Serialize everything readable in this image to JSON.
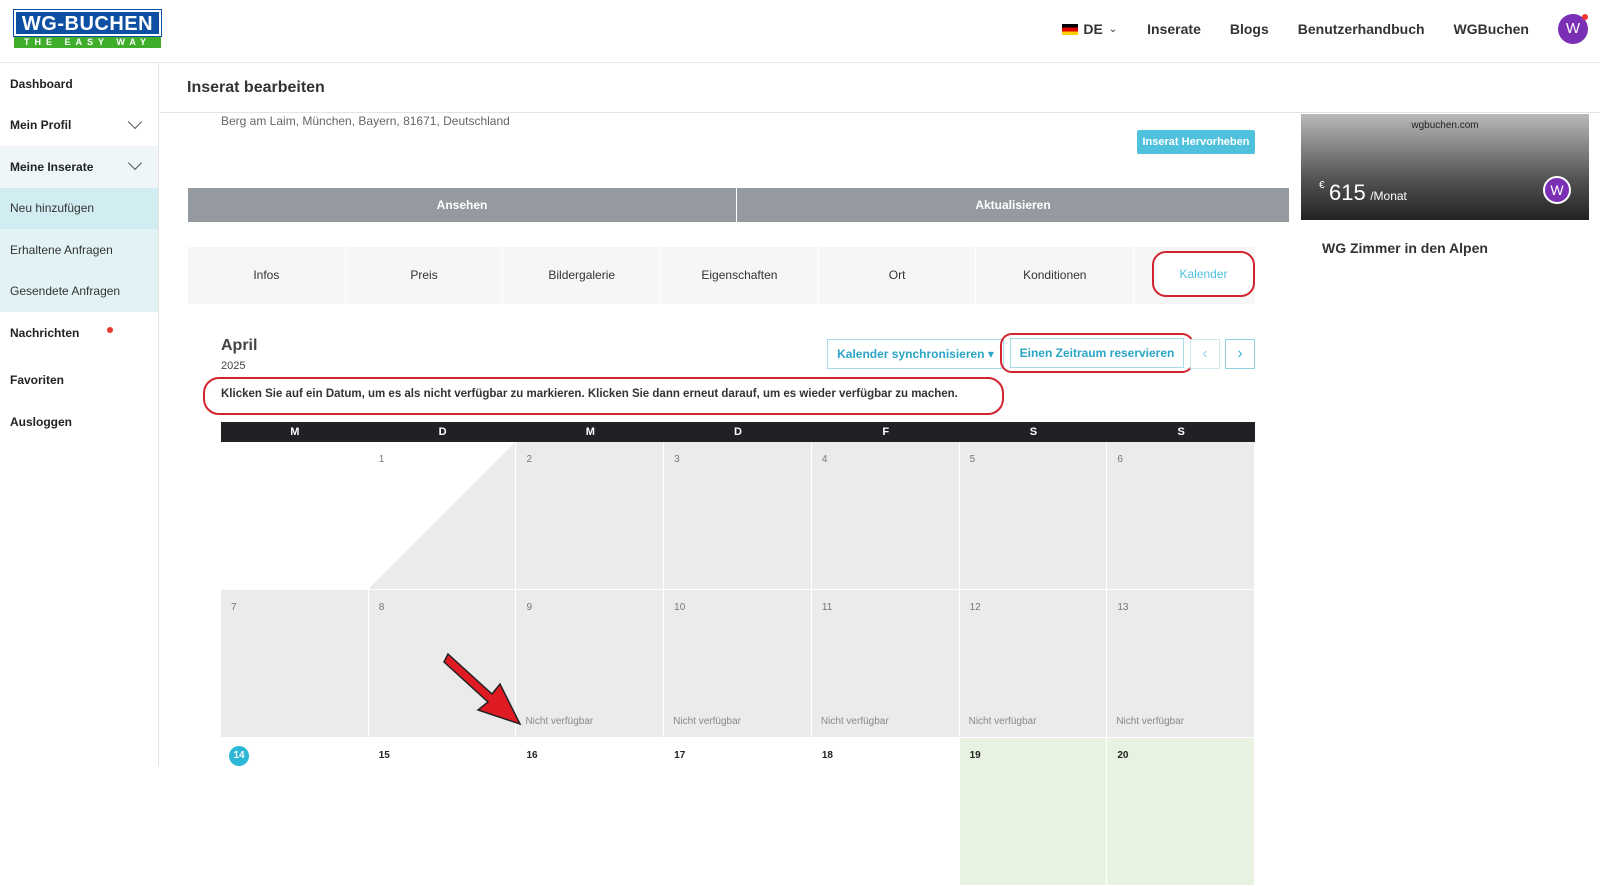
{
  "header": {
    "logo_main": "WG-BUCHEN",
    "logo_tagline": "THE EASY WAY",
    "language": "DE",
    "nav": [
      "Inserate",
      "Blogs",
      "Benutzerhandbuch",
      "WGBuchen"
    ],
    "avatar_letter": "W"
  },
  "sidebar": {
    "items": [
      {
        "label": "Dashboard"
      },
      {
        "label": "Mein Profil"
      },
      {
        "label": "Meine Inserate"
      },
      {
        "label": "Neu hinzufügen"
      },
      {
        "label": "Erhaltene Anfragen"
      },
      {
        "label": "Gesendete Anfragen"
      },
      {
        "label": "Nachrichten"
      },
      {
        "label": "Favoriten"
      },
      {
        "label": "Ausloggen"
      }
    ]
  },
  "page": {
    "title": "Inserat bearbeiten",
    "address": "Berg am Laim, München, Bayern, 81671, Deutschland",
    "highlight_button": "Inserat Hervorheben",
    "view_button": "Ansehen",
    "update_button": "Aktualisieren"
  },
  "tabs": [
    "Infos",
    "Preis",
    "Bildergalerie",
    "Eigenschaften",
    "Ort",
    "Konditionen",
    "Kalender"
  ],
  "calendar": {
    "month": "April",
    "year": "2025",
    "sync_button": "Kalender synchronisieren ▾",
    "reserve_button": "Einen Zeitraum reservieren",
    "prev": "‹",
    "next": "›",
    "hint": "Klicken Sie auf ein Datum, um es als nicht verfügbar zu markieren. Klicken Sie dann erneut darauf, um es wieder verfügbar zu machen.",
    "weekdays": [
      "M",
      "D",
      "M",
      "D",
      "F",
      "S",
      "S"
    ],
    "unavailable_label": "Nicht verfügbar",
    "week1": [
      "1",
      "2",
      "3",
      "4",
      "5",
      "6"
    ],
    "week2": [
      "7",
      "8",
      "9",
      "10",
      "11",
      "12",
      "13"
    ],
    "week3": [
      "14",
      "15",
      "16",
      "17",
      "18",
      "19",
      "20"
    ]
  },
  "preview": {
    "site": "wgbuchen.com",
    "currency": "€",
    "price": "615",
    "per": "/Monat",
    "avatar_letter": "W",
    "listing_title": "WG Zimmer in den Alpen"
  },
  "colors": {
    "accent": "#4fc1dd",
    "highlight_ring": "#d2242f",
    "avatar": "#7b2fb5",
    "available_green": "#e7f3e0"
  }
}
